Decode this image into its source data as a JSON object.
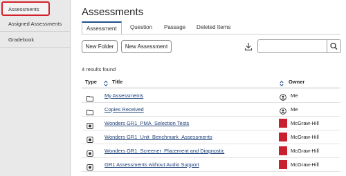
{
  "sidebar": {
    "items": [
      {
        "label": "Assessments",
        "active": true
      },
      {
        "label": "Assigned Assessments",
        "active": false
      },
      {
        "label": "Gradebook",
        "active": false
      }
    ]
  },
  "page": {
    "title": "Assessments"
  },
  "tabs": [
    {
      "label": "Assessment",
      "active": true
    },
    {
      "label": "Question",
      "active": false
    },
    {
      "label": "Passage",
      "active": false
    },
    {
      "label": "Deleted Items",
      "active": false
    }
  ],
  "toolbar": {
    "new_folder": "New Folder",
    "new_assessment": "New Assessment",
    "search_value": "",
    "download_icon": "download-icon",
    "search_icon": "search-icon"
  },
  "results": {
    "count_text": "4 results found"
  },
  "table": {
    "headers": {
      "type": "Type",
      "title": "Title",
      "owner": "Owner"
    },
    "rows": [
      {
        "type_icon": "folder-icon",
        "title": "My Assessments",
        "owner_icon": "user-icon",
        "owner": "Me"
      },
      {
        "type_icon": "folder-icon",
        "title": "Copies Received",
        "owner_icon": "user-icon",
        "owner": "Me"
      },
      {
        "type_icon": "assessment-icon",
        "title": "Wonders GR1_PMA_Selection Tests",
        "owner_icon": "mcgraw-hill-logo",
        "owner": "McGraw-Hill"
      },
      {
        "type_icon": "assessment-icon",
        "title": "Wonders GR1_Unit_Benchmark_Assessments",
        "owner_icon": "mcgraw-hill-logo",
        "owner": "McGraw-Hill"
      },
      {
        "type_icon": "assessment-icon",
        "title": "Wonders GR1_Screener_Placement and Diagnostic",
        "owner_icon": "mcgraw-hill-logo",
        "owner": "McGraw-Hill"
      },
      {
        "type_icon": "assessment-icon",
        "title": "GR1 Assessments without Audio Support",
        "owner_icon": "mcgraw-hill-logo",
        "owner": "McGraw-Hill"
      }
    ]
  },
  "colors": {
    "accent": "#1e4e8c",
    "highlight": "#d4202b",
    "brand": "#c8202f",
    "link": "#1c3f78"
  }
}
